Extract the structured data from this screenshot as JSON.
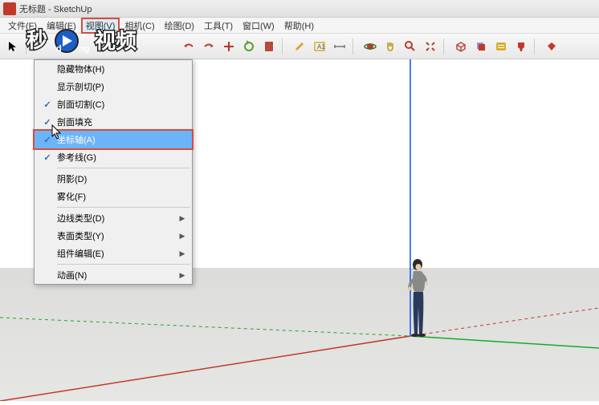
{
  "window": {
    "title": "无标题 - SketchUp"
  },
  "menubar": {
    "items": [
      {
        "label": "文件(F)"
      },
      {
        "label": "编辑(E)"
      },
      {
        "label": "视图(V)"
      },
      {
        "label": "相机(C)"
      },
      {
        "label": "绘图(D)"
      },
      {
        "label": "工具(T)"
      },
      {
        "label": "窗口(W)"
      },
      {
        "label": "帮助(H)"
      }
    ]
  },
  "dropdown": {
    "items": [
      {
        "label": "隐藏物体(H)",
        "checked": false
      },
      {
        "label": "显示剖切(P)",
        "checked": false
      },
      {
        "label": "剖面切割(C)",
        "checked": true
      },
      {
        "label": "剖面填充",
        "checked": true
      },
      {
        "label": "坐标轴(A)",
        "checked": true,
        "highlighted": true,
        "redbox": true
      },
      {
        "label": "参考线(G)",
        "checked": true
      }
    ],
    "group2": [
      {
        "label": "阴影(D)",
        "checked": false
      },
      {
        "label": "雾化(F)",
        "checked": false
      }
    ],
    "group3": [
      {
        "label": "边线类型(D)",
        "submenu": true
      },
      {
        "label": "表面类型(Y)",
        "submenu": true
      },
      {
        "label": "组件编辑(E)",
        "submenu": true
      }
    ],
    "group4": [
      {
        "label": "动画(N)",
        "submenu": true
      }
    ]
  },
  "overlay": {
    "logo_text_top": "秒",
    "logo_text_bottom": "视频"
  }
}
